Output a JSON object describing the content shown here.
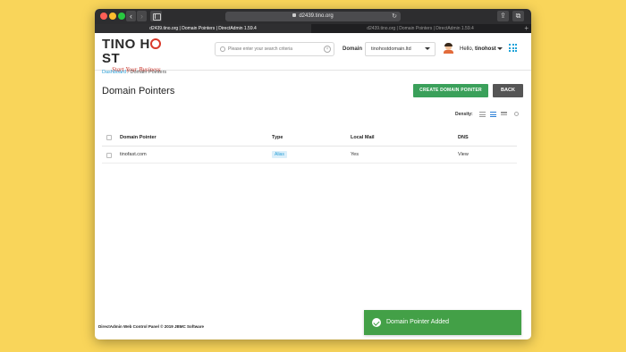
{
  "browser": {
    "url": "d2439.tino.org",
    "tabs": [
      {
        "label": "d2439.tino.org | Domain Pointers | DirectAdmin 1.59.4",
        "active": true
      },
      {
        "label": "d2439.tino.org | Domain Pointers | DirectAdmin 1.59.4",
        "active": false
      }
    ]
  },
  "header": {
    "logo_text_1": "TINO H",
    "logo_text_2": "ST",
    "tagline": "Start Your Business",
    "search_placeholder": "Please enter your search criteria",
    "domain_label": "Domain",
    "selected_domain": "tinohostdomain.ltd",
    "greeting": "Hello,",
    "username": "tinohost"
  },
  "breadcrumb": {
    "link": "Dashboard",
    "separator": " / ",
    "current": "Domain Pointers"
  },
  "page": {
    "title": "Domain Pointers",
    "create_button": "CREATE DOMAIN POINTER",
    "back_button": "BACK",
    "density_label": "Density:"
  },
  "table": {
    "columns": [
      "Domain Pointer",
      "Type",
      "Local Mail",
      "DNS"
    ],
    "rows": [
      {
        "domain": "tinofast.com",
        "type": "Alias",
        "local_mail": "Yes",
        "dns": "View"
      }
    ]
  },
  "footer": {
    "text": "DirectAdmin Web Control Panel © 2019 JBMC Software"
  },
  "toast": {
    "message": "Domain Pointer Added",
    "color": "#43a047"
  },
  "colors": {
    "accent_green": "#3aa05a",
    "link_blue": "#2a9fd6",
    "back_button": "#555555",
    "background": "#f9d55a"
  }
}
